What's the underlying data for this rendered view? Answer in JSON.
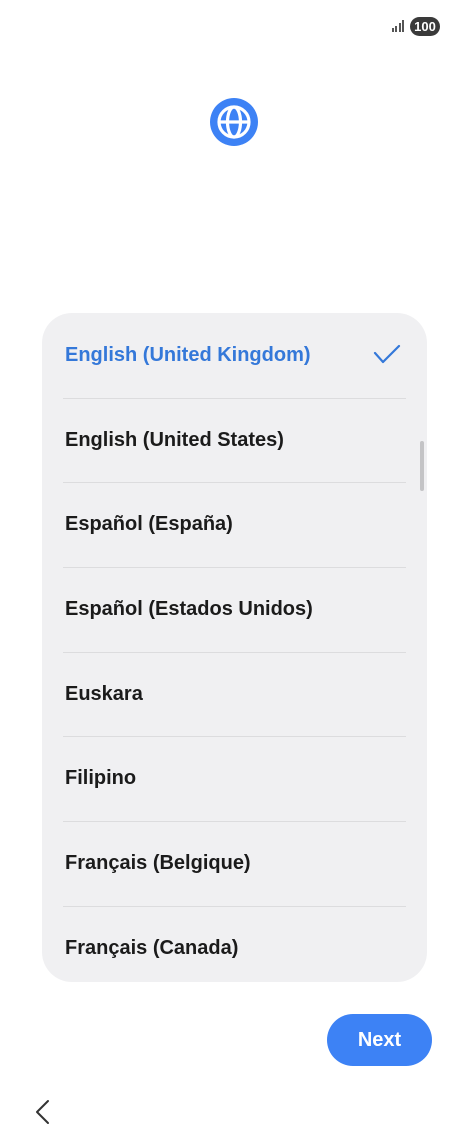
{
  "status_bar": {
    "signal_icon": "signal-icon",
    "battery": "100"
  },
  "header": {
    "icon": "globe-icon",
    "accent_color": "#3d82f5"
  },
  "language_list": {
    "selected_color": "#3478d9",
    "items": [
      {
        "label": "English (United Kingdom)",
        "selected": true
      },
      {
        "label": "English (United States)",
        "selected": false
      },
      {
        "label": "Español (España)",
        "selected": false
      },
      {
        "label": "Español (Estados Unidos)",
        "selected": false
      },
      {
        "label": "Euskara",
        "selected": false
      },
      {
        "label": "Filipino",
        "selected": false
      },
      {
        "label": "Français (Belgique)",
        "selected": false
      },
      {
        "label": "Français (Canada)",
        "selected": false
      }
    ]
  },
  "footer": {
    "next_label": "Next",
    "back_icon": "back-arrow-icon"
  }
}
